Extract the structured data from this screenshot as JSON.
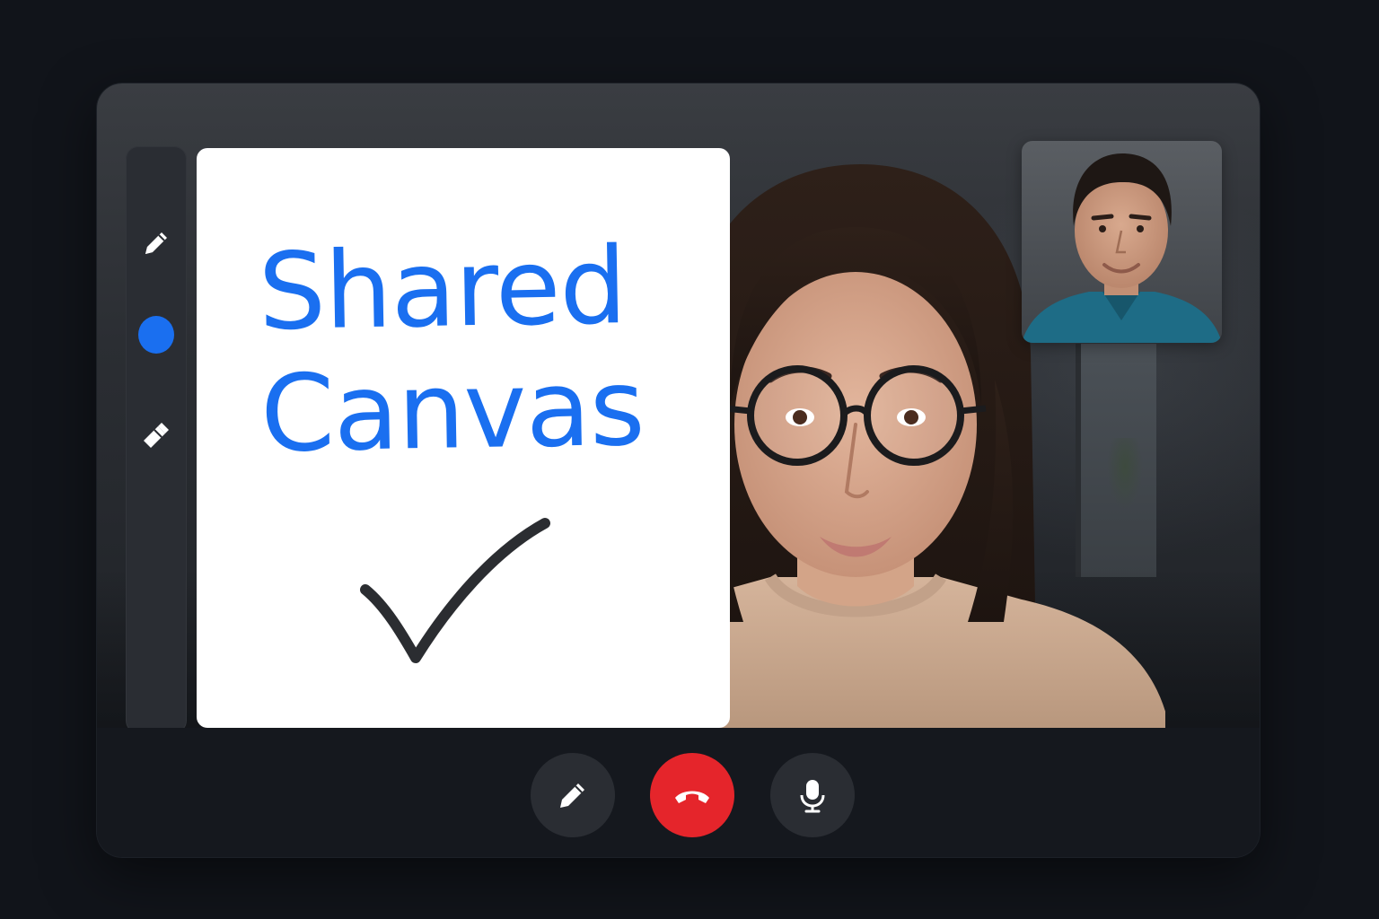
{
  "canvas": {
    "title_line1": "Shared",
    "title_line2": "Canvas",
    "ink_color": "#1a6ff0",
    "check_color": "#2b2d31"
  },
  "toolbar": {
    "tools": [
      {
        "id": "pen",
        "icon": "pencil-icon"
      },
      {
        "id": "color",
        "icon": "color-swatch",
        "color": "#1a6ff0"
      },
      {
        "id": "eraser",
        "icon": "eraser-icon"
      }
    ]
  },
  "controls": {
    "draw": {
      "icon": "pencil-icon",
      "color": "#2a2d33"
    },
    "hangup": {
      "icon": "phone-hangup-icon",
      "color": "#e5252b"
    },
    "mic": {
      "icon": "microphone-icon",
      "color": "#2a2d33"
    }
  },
  "colors": {
    "background": "#11141a",
    "window": "#15181e",
    "panel": "#2a2d33",
    "accent": "#1a6ff0",
    "danger": "#e5252b"
  }
}
